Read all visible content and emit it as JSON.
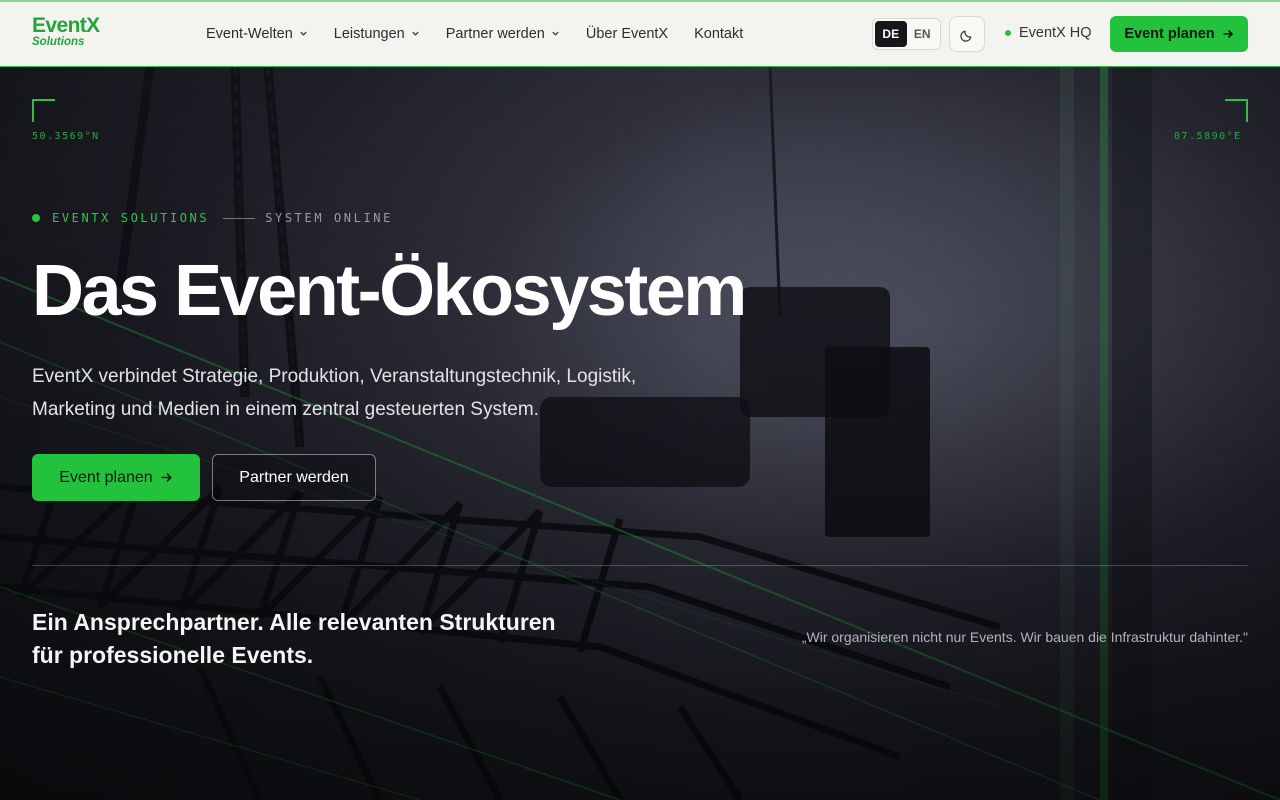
{
  "header": {
    "logo": {
      "name": "EventX",
      "sub": "Solutions"
    },
    "nav": [
      {
        "label": "Event-Welten",
        "dropdown": true
      },
      {
        "label": "Leistungen",
        "dropdown": true
      },
      {
        "label": "Partner werden",
        "dropdown": true
      },
      {
        "label": "Über EventX",
        "dropdown": false
      },
      {
        "label": "Kontakt",
        "dropdown": false
      }
    ],
    "languages": [
      {
        "code": "DE",
        "active": true
      },
      {
        "code": "EN",
        "active": false
      }
    ],
    "theme_toggle_icon": "moon-icon",
    "status_label": "EventX HQ",
    "cta_label": "Event planen",
    "cta_icon": "arrow-right-icon"
  },
  "hero": {
    "coord_left": "50.3569°N",
    "coord_right": "07.5890°E",
    "eyebrow_brand": "EVENTX SOLUTIONS",
    "eyebrow_status": "SYSTEM ONLINE",
    "title": "Das Event-Ökosystem",
    "lead": "EventX verbindet Strategie, Produktion, Veranstaltungstechnik, Logistik, Marketing und Medien in einem zentral gesteuerten System.",
    "primary_button": "Event planen",
    "primary_button_icon": "arrow-right-icon",
    "secondary_button": "Partner werden",
    "tagline": "Ein Ansprechpartner. Alle relevanten Strukturen für professionelle Events.",
    "quote": "„Wir organisieren nicht nur Events. Wir bauen die Infrastruktur dahinter.\""
  },
  "colors": {
    "accent": "#22c23d",
    "accent_dark": "#22a63a",
    "header_bg": "#f3f3ef",
    "hero_bg": "#24252e",
    "text_light": "#ffffff"
  }
}
